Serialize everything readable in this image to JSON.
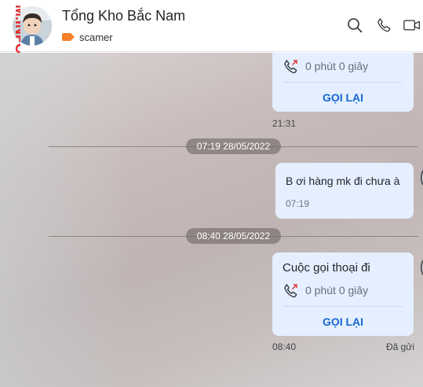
{
  "header": {
    "contact_name": "Tổng Kho Bắc Nam",
    "tag_label": "scamer",
    "tag_color": "#f5822a",
    "watermark": "M.INFO",
    "icons": [
      "search-icon",
      "phone-icon",
      "video-call-icon"
    ]
  },
  "messages": {
    "call1": {
      "duration": "0 phút 0 giây",
      "action": "GỌI LẠI",
      "time": "21:31"
    },
    "separator1": "07:19 28/05/2022",
    "text1": {
      "text": "B ơi hàng mk đi chưa à",
      "time": "07:19"
    },
    "separator2": "08:40 28/05/2022",
    "call2": {
      "title": "Cuộc gọi thoại đi",
      "duration": "0 phút 0 giây",
      "action": "GỌI LẠI",
      "time": "08:40",
      "status": "Đã gửi"
    }
  },
  "colors": {
    "bubble": "#e5efff",
    "action": "#1566d3",
    "missed_call_arrow": "#e03a3a"
  }
}
